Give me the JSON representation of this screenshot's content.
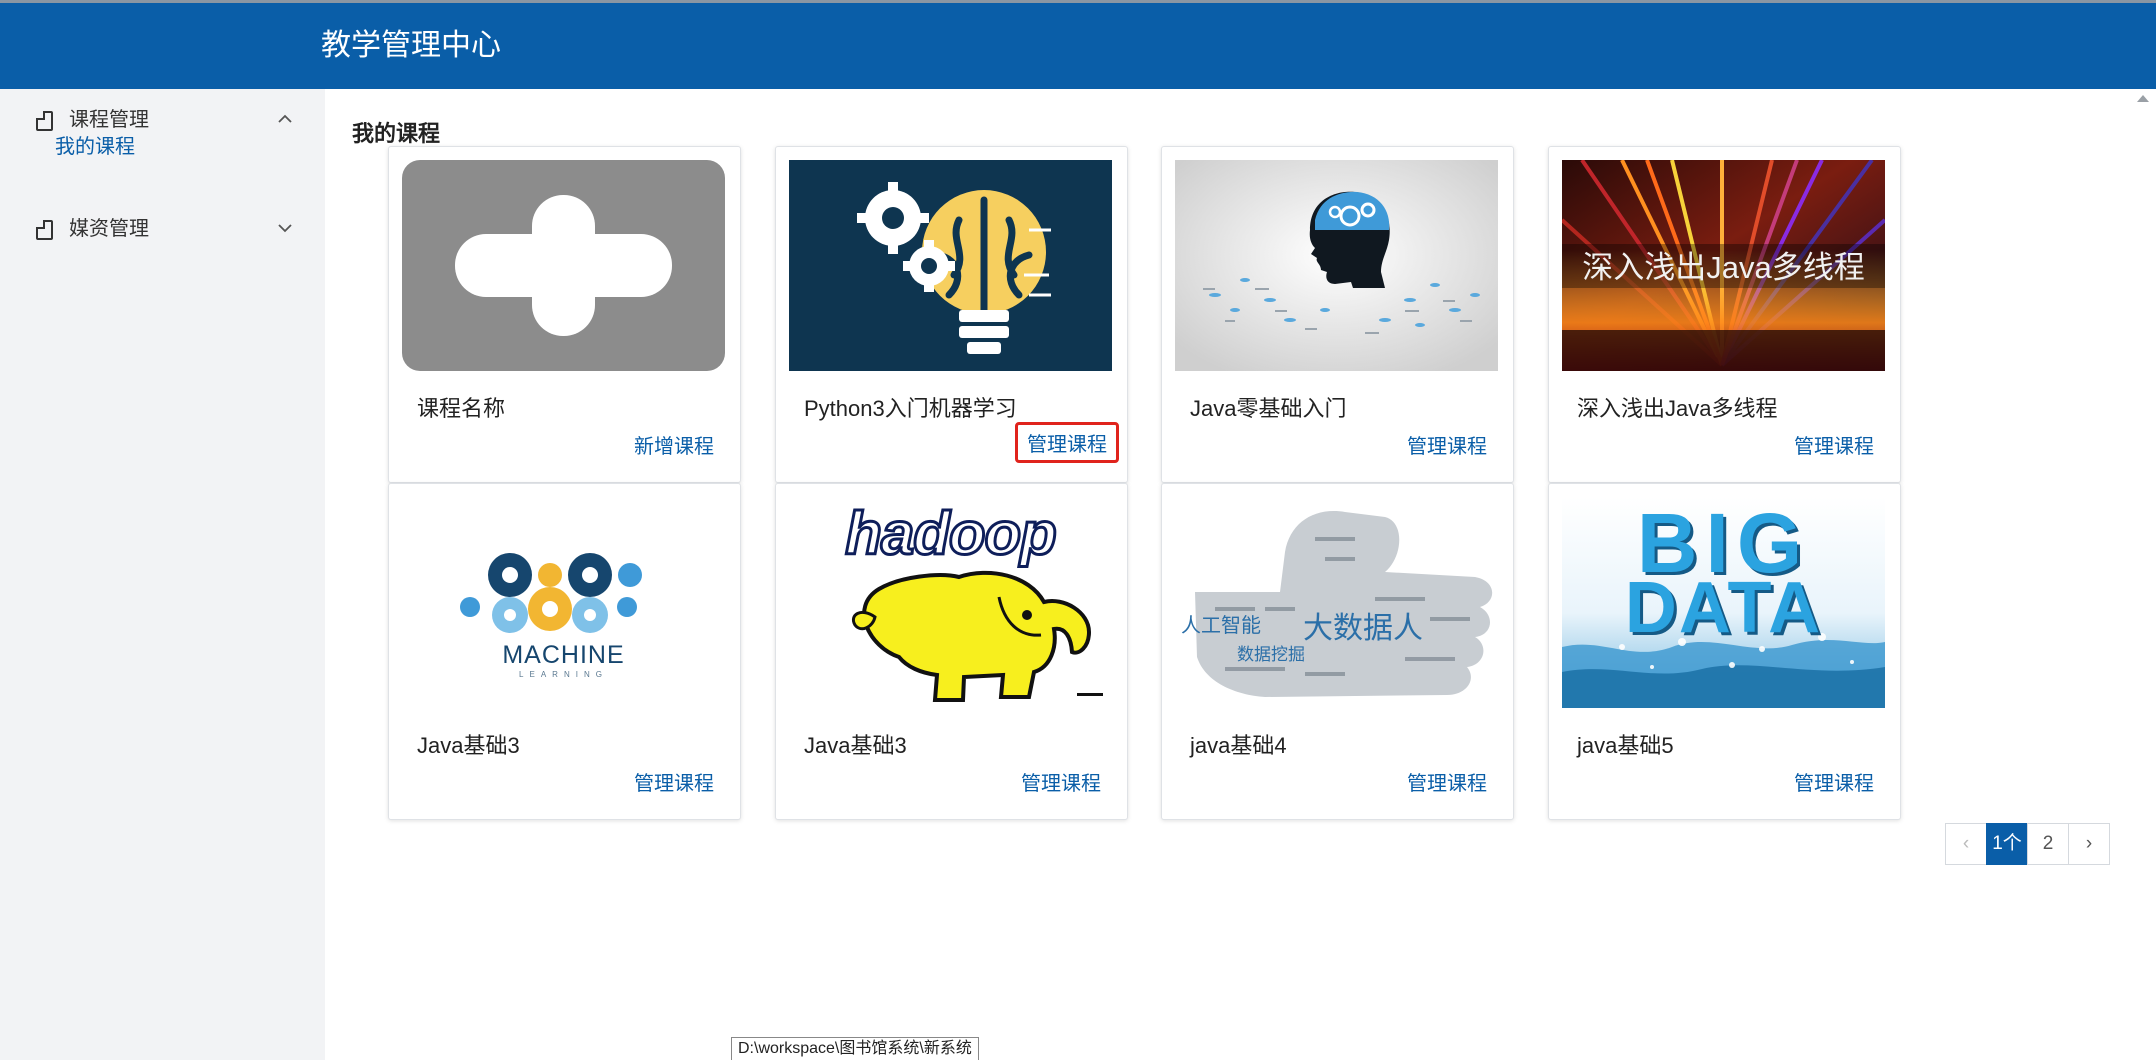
{
  "header": {
    "title": "教学管理中心"
  },
  "sidebar": {
    "groups": [
      {
        "label": "课程管理",
        "expanded": true,
        "icon": "document-icon",
        "items": [
          {
            "label": "我的课程"
          }
        ]
      },
      {
        "label": "媒资管理",
        "expanded": false,
        "icon": "document-icon"
      }
    ]
  },
  "main": {
    "title": "我的课程",
    "cards": [
      {
        "name": "课程名称",
        "action": "新增课程",
        "image": "add-plus"
      },
      {
        "name": "Python3入门机器学习",
        "action": "管理课程",
        "image": "brain-lightbulb",
        "highlighted": true
      },
      {
        "name": "Java零基础入门",
        "action": "管理课程",
        "image": "head-gears"
      },
      {
        "name": "深入浅出Java多线程",
        "action": "管理课程",
        "image": "colorful-rays",
        "overlay_text": "深入浅出Java多线程"
      },
      {
        "name": "Java基础3",
        "action": "管理课程",
        "image": "machine-learning",
        "logo_text": "MACHINE",
        "logo_subtext": "LEARNING"
      },
      {
        "name": "Java基础3",
        "action": "管理课程",
        "image": "hadoop",
        "logo_text": "hadoop"
      },
      {
        "name": "java基础4",
        "action": "管理课程",
        "image": "thumbs-up-wordcloud",
        "cloud_words": [
          "人工智能",
          "大数据人",
          "数据挖掘"
        ]
      },
      {
        "name": "java基础5",
        "action": "管理课程",
        "image": "big-data",
        "logo_text": [
          "BIG",
          "DATA"
        ]
      }
    ]
  },
  "pagination": {
    "prev": "‹",
    "pages": [
      "1个",
      "2"
    ],
    "current": 1,
    "next": "›"
  },
  "statusbar": {
    "text": "D:\\workspace\\图书馆系统\\新系统"
  },
  "colors": {
    "primary": "#0a5ea8",
    "highlight": "#e0231c",
    "sidebar_bg": "#f2f3f5"
  }
}
